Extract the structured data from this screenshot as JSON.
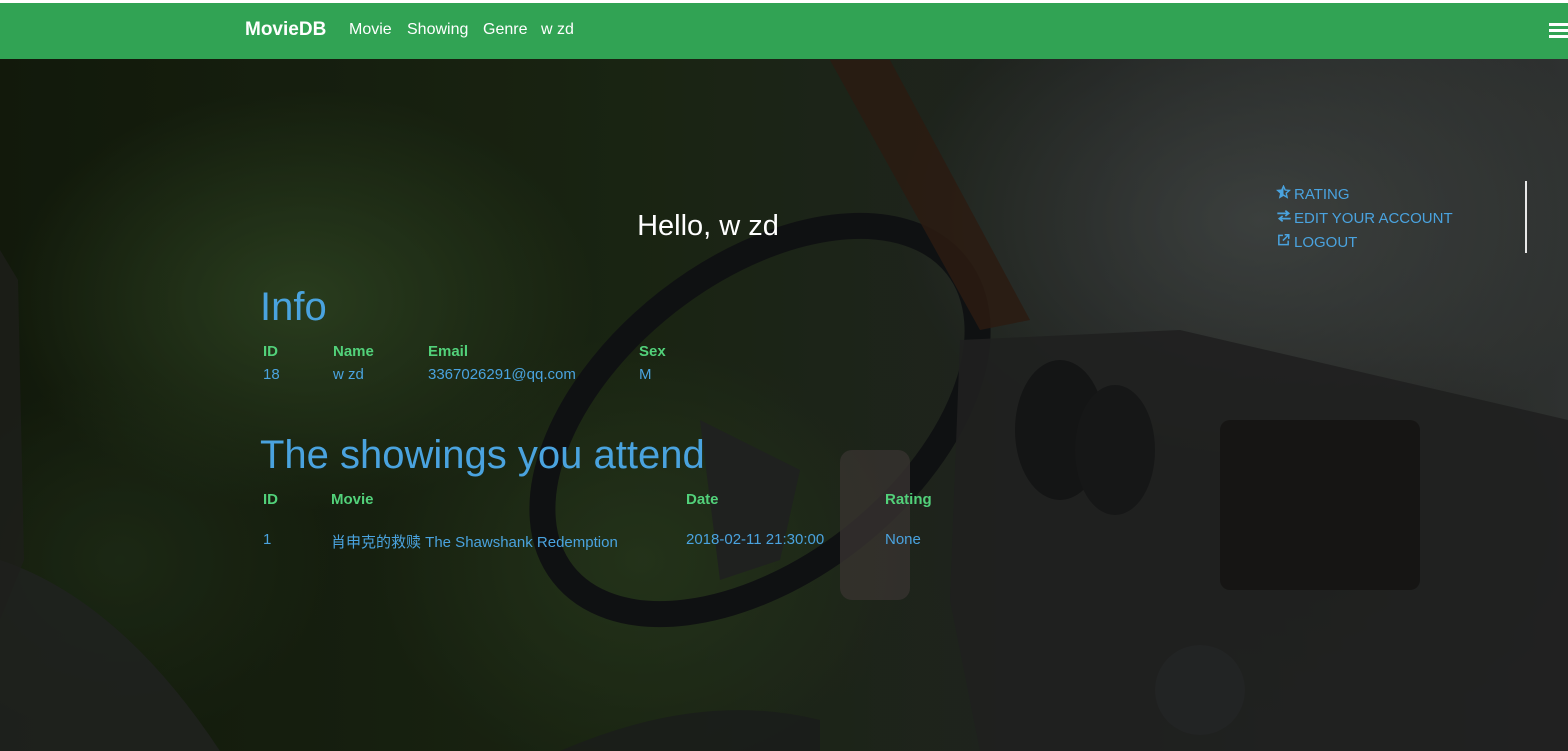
{
  "navbar": {
    "brand": "MovieDB",
    "links": [
      "Movie",
      "Showing",
      "Genre",
      "w zd"
    ],
    "menu_icon": "hamburger-icon",
    "background": "#31a354"
  },
  "side_menu": {
    "items": [
      {
        "label": "RATING",
        "icon": "star-icon"
      },
      {
        "label": "EDIT YOUR ACCOUNT",
        "icon": "exchange-icon"
      },
      {
        "label": "LOGOUT",
        "icon": "external-link-icon"
      }
    ]
  },
  "greeting": "Hello, w zd",
  "info": {
    "heading": "Info",
    "columns": [
      "ID",
      "Name",
      "Email",
      "Sex"
    ],
    "values": [
      "18",
      "w zd",
      "3367026291@qq.com",
      "M"
    ]
  },
  "showings": {
    "heading": "The showings you attend",
    "columns": [
      "ID",
      "Movie",
      "Date",
      "Rating"
    ],
    "rows": [
      [
        "1",
        "肖申克的救赎 The Shawshank Redemption",
        "2018-02-11 21:30:00",
        "None"
      ]
    ]
  },
  "colors": {
    "accent": "#4aa3df",
    "header_text": "#52d17a",
    "navbar": "#31a354"
  }
}
